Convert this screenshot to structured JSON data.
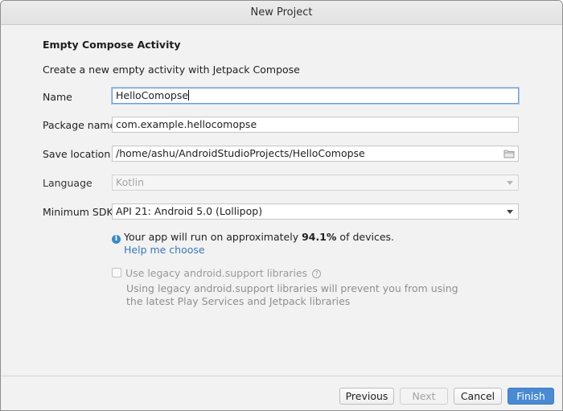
{
  "window": {
    "title": "New Project"
  },
  "page": {
    "heading": "Empty Compose Activity",
    "description": "Create a new empty activity with Jetpack Compose"
  },
  "form": {
    "name": {
      "label": "Name",
      "value": "HelloComopse"
    },
    "package": {
      "label": "Package name",
      "value": "com.example.hellocomopse"
    },
    "save_location": {
      "label": "Save location",
      "value": "/home/ashu/AndroidStudioProjects/HelloComopse",
      "icon": "folder-icon"
    },
    "language": {
      "label": "Language",
      "value": "Kotlin"
    },
    "min_sdk": {
      "label": "Minimum SDK",
      "value": "API 21: Android 5.0 (Lollipop)"
    }
  },
  "info": {
    "icon": "info-icon",
    "prefix": "Your app will run on approximately ",
    "percent": "94.1%",
    "suffix": " of devices.",
    "help_link": "Help me choose"
  },
  "legacy": {
    "checkbox_label": "Use legacy android.support libraries",
    "help_icon": "?",
    "description": "Using legacy android.support libraries will prevent you from using the latest Play Services and Jetpack libraries"
  },
  "footer": {
    "previous": "Previous",
    "next": "Next",
    "cancel": "Cancel",
    "finish": "Finish"
  },
  "colors": {
    "accent": "#4a8ad2",
    "link": "#3b78b8",
    "info_icon": "#3a87c8"
  }
}
